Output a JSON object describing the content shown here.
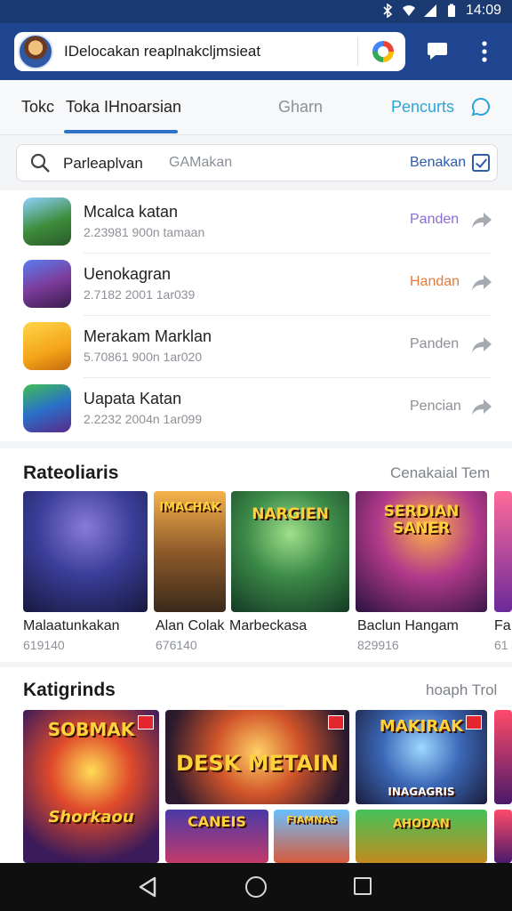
{
  "status_bar": {
    "time": "14:09",
    "icons": [
      "bluetooth-icon",
      "wifi-icon",
      "signal-icon",
      "battery-icon"
    ]
  },
  "header": {
    "search_text": "IDelocakan reaplnakcljmsieat",
    "icons": [
      "avatar",
      "google-icon",
      "chat-icon",
      "more-vert-icon"
    ],
    "bg_color": "#1f4490"
  },
  "tabs": {
    "items": [
      "Tokc",
      "Toka IHnoarsian",
      "Gharn",
      "Pencurts"
    ],
    "active_index": 1,
    "accent_color": "#2d72c9"
  },
  "filter": {
    "label": "Parleaplvan",
    "sub_label": "GAMakan",
    "action": "Benakan"
  },
  "list": [
    {
      "name": "Mcalca katan",
      "meta": "2.23981   900n tamaan",
      "action": "Panden",
      "action_color": "#8a6bd6"
    },
    {
      "name": "Uenokagran",
      "meta": "2.7182   2001 1ar039",
      "action": "Handan",
      "action_color": "#e37b3a"
    },
    {
      "name": "Merakam Marklan",
      "meta": "5.70861   900n 1ar020",
      "action": "Panden",
      "action_color": "#8c9097"
    },
    {
      "name": "Uapata Katan",
      "meta": "2.2232   2004n 1ar099",
      "action": "Pencian",
      "action_color": "#8c9097"
    }
  ],
  "section1": {
    "title": "Rateoliaris",
    "more": "Cenakaial Tem",
    "cards": [
      {
        "title": "Malaatunkakan",
        "meta": "619140"
      },
      {
        "title": "Alan Colak",
        "meta": "676140",
        "art": "IMACHAK"
      },
      {
        "title": "Marbeckasa",
        "meta": "",
        "art": "NARGIEN"
      },
      {
        "title": "Baclun Hangam",
        "meta": "829916",
        "art": "SERDIAN SANER"
      },
      {
        "title": "Fa",
        "meta": "61"
      }
    ]
  },
  "section2": {
    "title": "Katigrinds",
    "more": "hoaph Trol",
    "art_texts": [
      "SOBMAK",
      "Shorkaou",
      "DESK METAIN",
      "MAKIRAK",
      "INAGAGRIS",
      "CANEIS",
      "FIAMNAS",
      "AHODAN"
    ]
  },
  "nav": {
    "icons": [
      "back-icon",
      "home-icon",
      "recents-icon"
    ]
  }
}
